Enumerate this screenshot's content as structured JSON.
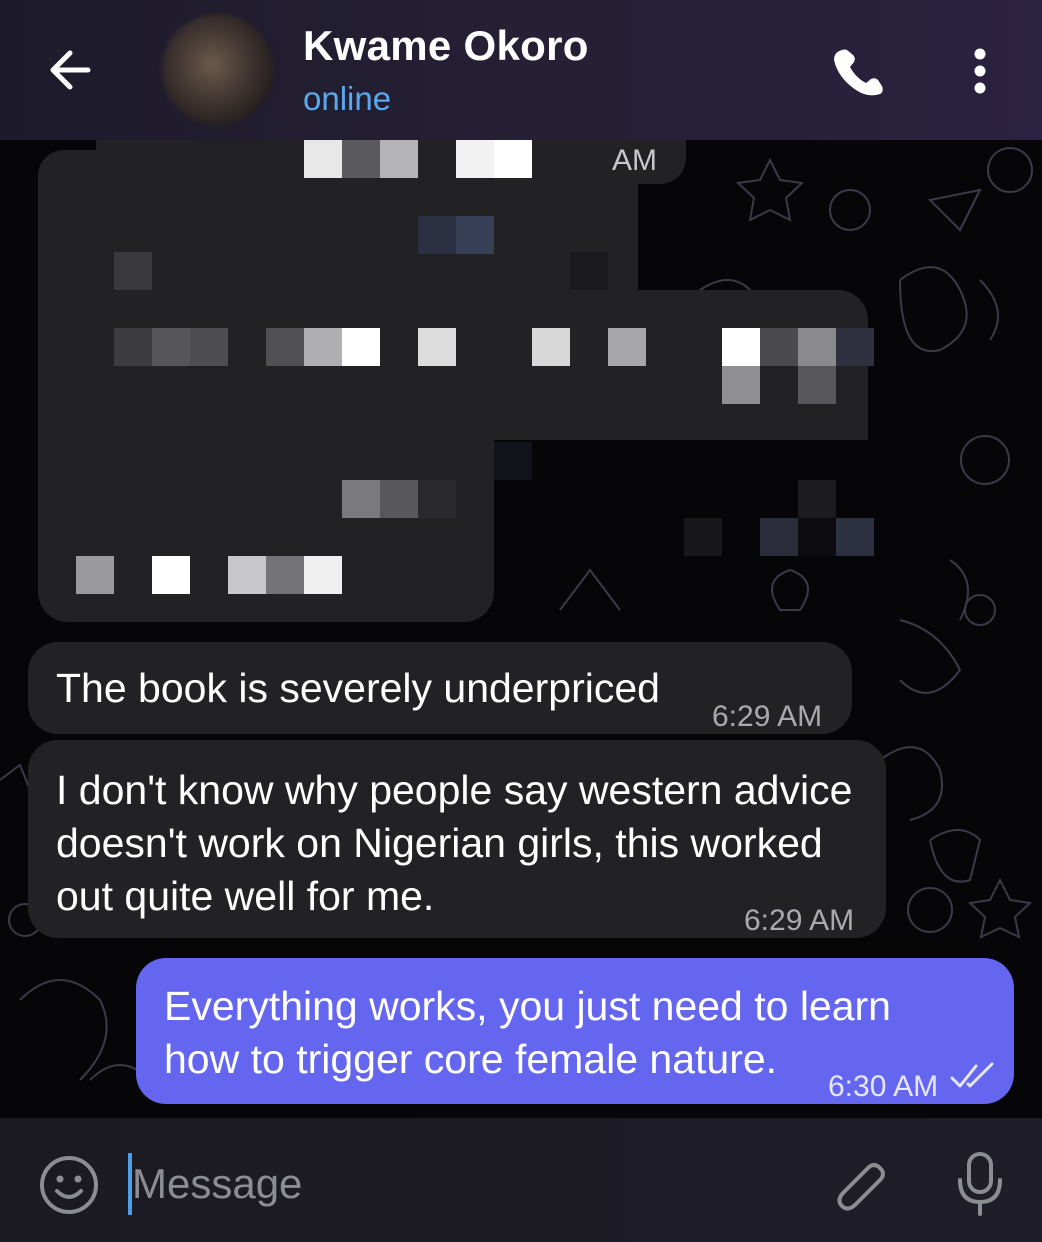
{
  "header": {
    "back_icon": "arrow-left-icon",
    "contact_name": "Kwame Okoro",
    "status": "online",
    "call_icon": "phone-icon",
    "more_icon": "more-vertical-icon"
  },
  "redacted_message": {
    "partial_time": "AM"
  },
  "messages": [
    {
      "direction": "incoming",
      "text": "The book is severely underpriced",
      "time": "6:29 AM"
    },
    {
      "direction": "incoming",
      "text": "I don't know why people say western advice doesn't work on Nigerian girls, this worked out quite well for me.",
      "time": "6:29 AM"
    },
    {
      "direction": "outgoing",
      "text": "Everything works, you just need to learn how to trigger core female nature.",
      "time": "6:30 AM",
      "status_icon": "double-check-icon"
    }
  ],
  "composer": {
    "placeholder": "Message",
    "emoji_icon": "smile-icon",
    "attach_icon": "paperclip-icon",
    "mic_icon": "microphone-icon"
  },
  "colors": {
    "header_bg": "#241f33",
    "status": "#5aa8ee",
    "incoming_bubble": "#222224",
    "outgoing_bubble": "#6466ef",
    "background": "#060608"
  }
}
